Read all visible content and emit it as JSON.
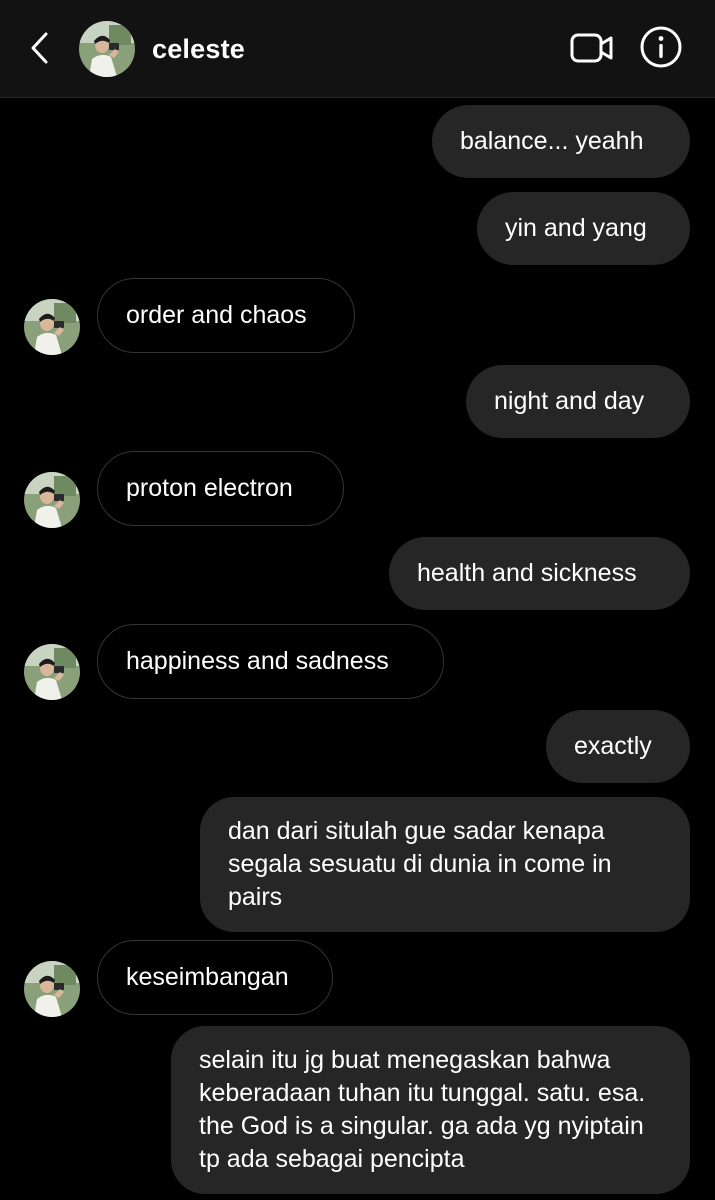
{
  "header": {
    "contact_name": "celeste",
    "back_icon": "chevron-left-icon",
    "video_icon": "video-camera-icon",
    "info_icon": "info-icon"
  },
  "messages": [
    {
      "direction": "outgoing",
      "text": "balance... yeahh"
    },
    {
      "direction": "outgoing",
      "text": "yin and yang"
    },
    {
      "direction": "incoming",
      "text": "order and chaos"
    },
    {
      "direction": "outgoing",
      "text": "night and day"
    },
    {
      "direction": "incoming",
      "text": "proton electron"
    },
    {
      "direction": "outgoing",
      "text": "health and sickness"
    },
    {
      "direction": "incoming",
      "text": "happiness and sadness"
    },
    {
      "direction": "outgoing",
      "text": "exactly"
    },
    {
      "direction": "outgoing",
      "text": "dan dari situlah gue sadar kenapa segala sesuatu di dunia in come in pairs"
    },
    {
      "direction": "incoming",
      "text": "keseimbangan"
    },
    {
      "direction": "outgoing",
      "text": "selain itu jg buat menegaskan bahwa keberadaan tuhan itu tunggal. satu. esa. the God is a singular. ga ada yg nyiptain tp ada sebagai pencipta"
    }
  ],
  "colors": {
    "background": "#000000",
    "header_bg": "#121212",
    "outgoing_bubble": "#262626",
    "incoming_border": "#333333",
    "text": "#ffffff"
  }
}
